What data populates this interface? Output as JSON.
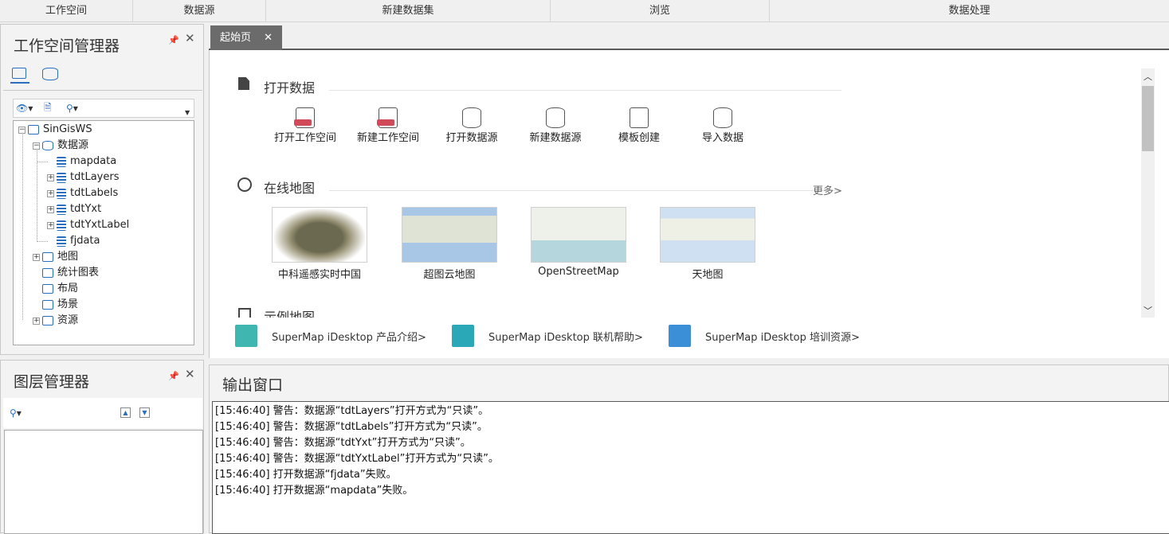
{
  "ribbon": {
    "groups": [
      "工作空间",
      "数据源",
      "新建数据集",
      "浏览",
      "数据处理"
    ]
  },
  "workspace_manager": {
    "title": "工作空间管理器",
    "tree": {
      "root": "SinGisWS",
      "datasources_label": "数据源",
      "datasources": [
        "mapdata",
        "tdtLayers",
        "tdtLabels",
        "tdtYxt",
        "tdtYxtLabel",
        "fjdata"
      ],
      "maps": "地图",
      "charts": "统计图表",
      "layouts": "布局",
      "scenes": "场景",
      "resources": "资源"
    }
  },
  "layer_manager": {
    "title": "图层管理器"
  },
  "start_page": {
    "tab_label": "起始页",
    "open_data_title": "打开数据",
    "quick_actions": [
      {
        "label": "打开工作空间",
        "icon": "open-workspace-icon"
      },
      {
        "label": "新建工作空间",
        "icon": "new-workspace-icon"
      },
      {
        "label": "打开数据源",
        "icon": "open-datasource-icon"
      },
      {
        "label": "新建数据源",
        "icon": "new-datasource-icon"
      },
      {
        "label": "模板创建",
        "icon": "template-create-icon"
      },
      {
        "label": "导入数据",
        "icon": "import-data-icon"
      }
    ],
    "online_map_title": "在线地图",
    "more_label": "更多>",
    "online_maps": [
      "中科遥感实时中国",
      "超图云地图",
      "OpenStreetMap",
      "天地图"
    ],
    "example_map_title": "示例地图",
    "links": [
      "SuperMap iDesktop 产品介绍>",
      "SuperMap iDesktop 联机帮助>",
      "SuperMap iDesktop 培训资源>"
    ]
  },
  "output_window": {
    "title": "输出窗口",
    "lines": [
      {
        "time": "[15:46:40]",
        "text": "警告：数据源“tdtLayers”打开方式为“只读”。"
      },
      {
        "time": "[15:46:40]",
        "text": "警告：数据源“tdtLabels”打开方式为“只读”。"
      },
      {
        "time": "[15:46:40]",
        "text": "警告：数据源“tdtYxt”打开方式为“只读”。"
      },
      {
        "time": "[15:46:40]",
        "text": "警告：数据源“tdtYxtLabel”打开方式为“只读”。"
      },
      {
        "time": "[15:46:40]",
        "text": "打开数据源“fjdata”失败。"
      },
      {
        "time": "[15:46:40]",
        "text": "打开数据源“mapdata”失败。"
      }
    ]
  },
  "colors": {
    "accent": "#2a6ebf",
    "tab_active_bg": "#6b6b6b",
    "warning_red": "#d04a5a"
  }
}
